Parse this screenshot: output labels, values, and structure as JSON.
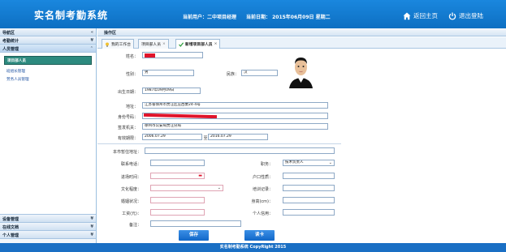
{
  "header": {
    "app_title": "实名制考勤系统",
    "current_user": "当前用户：二中项目经理",
    "current_date": "当前日期： 2015年06月09日 星期二",
    "home_label": "返回主页",
    "logout_label": "退出登陆"
  },
  "sidebar": {
    "nav_title": "导航区",
    "sections": [
      "考勤统计",
      "人员管理",
      "设备管理",
      "在线文档",
      "个人管理"
    ],
    "items": [
      "项目部人员",
      "班组长管理",
      "劳务人员管理"
    ]
  },
  "ops_title": "操作区",
  "tabs": [
    "我的工作台",
    "项目部人员",
    "新增项目部人员"
  ],
  "form": {
    "name_label": "姓名：",
    "gender_label": "性别：",
    "gender_value": "男",
    "ethnicity_label": "民族：",
    "ethnicity_value": "汉",
    "birth_label": "出生日期：",
    "birth_value": "1987年09月09日",
    "address_label": "地址：",
    "address_value": "江苏省徐州市贾汪区庄西委24-4号",
    "idno_label": "身份号码：",
    "authority_label": "签发机关：",
    "authority_value": "徐州市公安局贾汪分局",
    "validity_label": "有效期限：",
    "valid_from": "2006.07.29",
    "valid_to_sep": "至",
    "valid_to": "2016.07.29",
    "current_address_label": "本市暂住地址：",
    "phone_label": "联系电话：",
    "job_label": "职务：",
    "job_value": "技术负责人",
    "entry_label": "进场时间：",
    "hukou_label": "户口性质：",
    "education_label": "文化程度：",
    "training_label": "培训记录：",
    "marital_label": "婚姻状况：",
    "height_label": "身高(cm)：",
    "wage_label": "工资(元)：",
    "credit_label": "个人信用：",
    "remark_label": "备注：",
    "save_label": "保存",
    "readcard_label": "读卡"
  },
  "footer_text": "实名制考勤系统 CopyRight 2015",
  "colors": {
    "header": "#1a87de",
    "footer": "#1a6fc4",
    "accent": "#2d8a7f",
    "redact": "#e0142b"
  }
}
